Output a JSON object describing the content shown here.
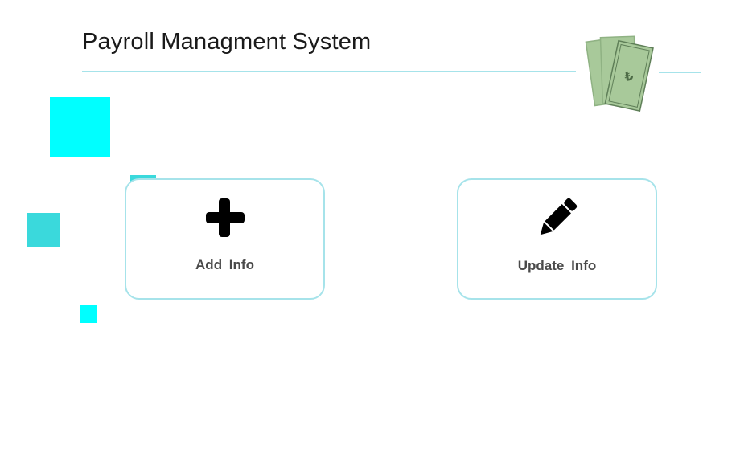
{
  "app": {
    "title": "Payroll Managment System"
  },
  "actions": {
    "add_label": "Add  Info",
    "update_label": "Update  Info"
  },
  "colors": {
    "accent_line": "#a6e3ea",
    "cyan": "#00ffff",
    "teal": "#3ad9dc",
    "money_green": "#a8c99a",
    "label_gray": "#4a4a4a"
  },
  "icons": {
    "logo": "money-bills-icon",
    "add": "plus-icon",
    "update": "pencil-icon"
  }
}
